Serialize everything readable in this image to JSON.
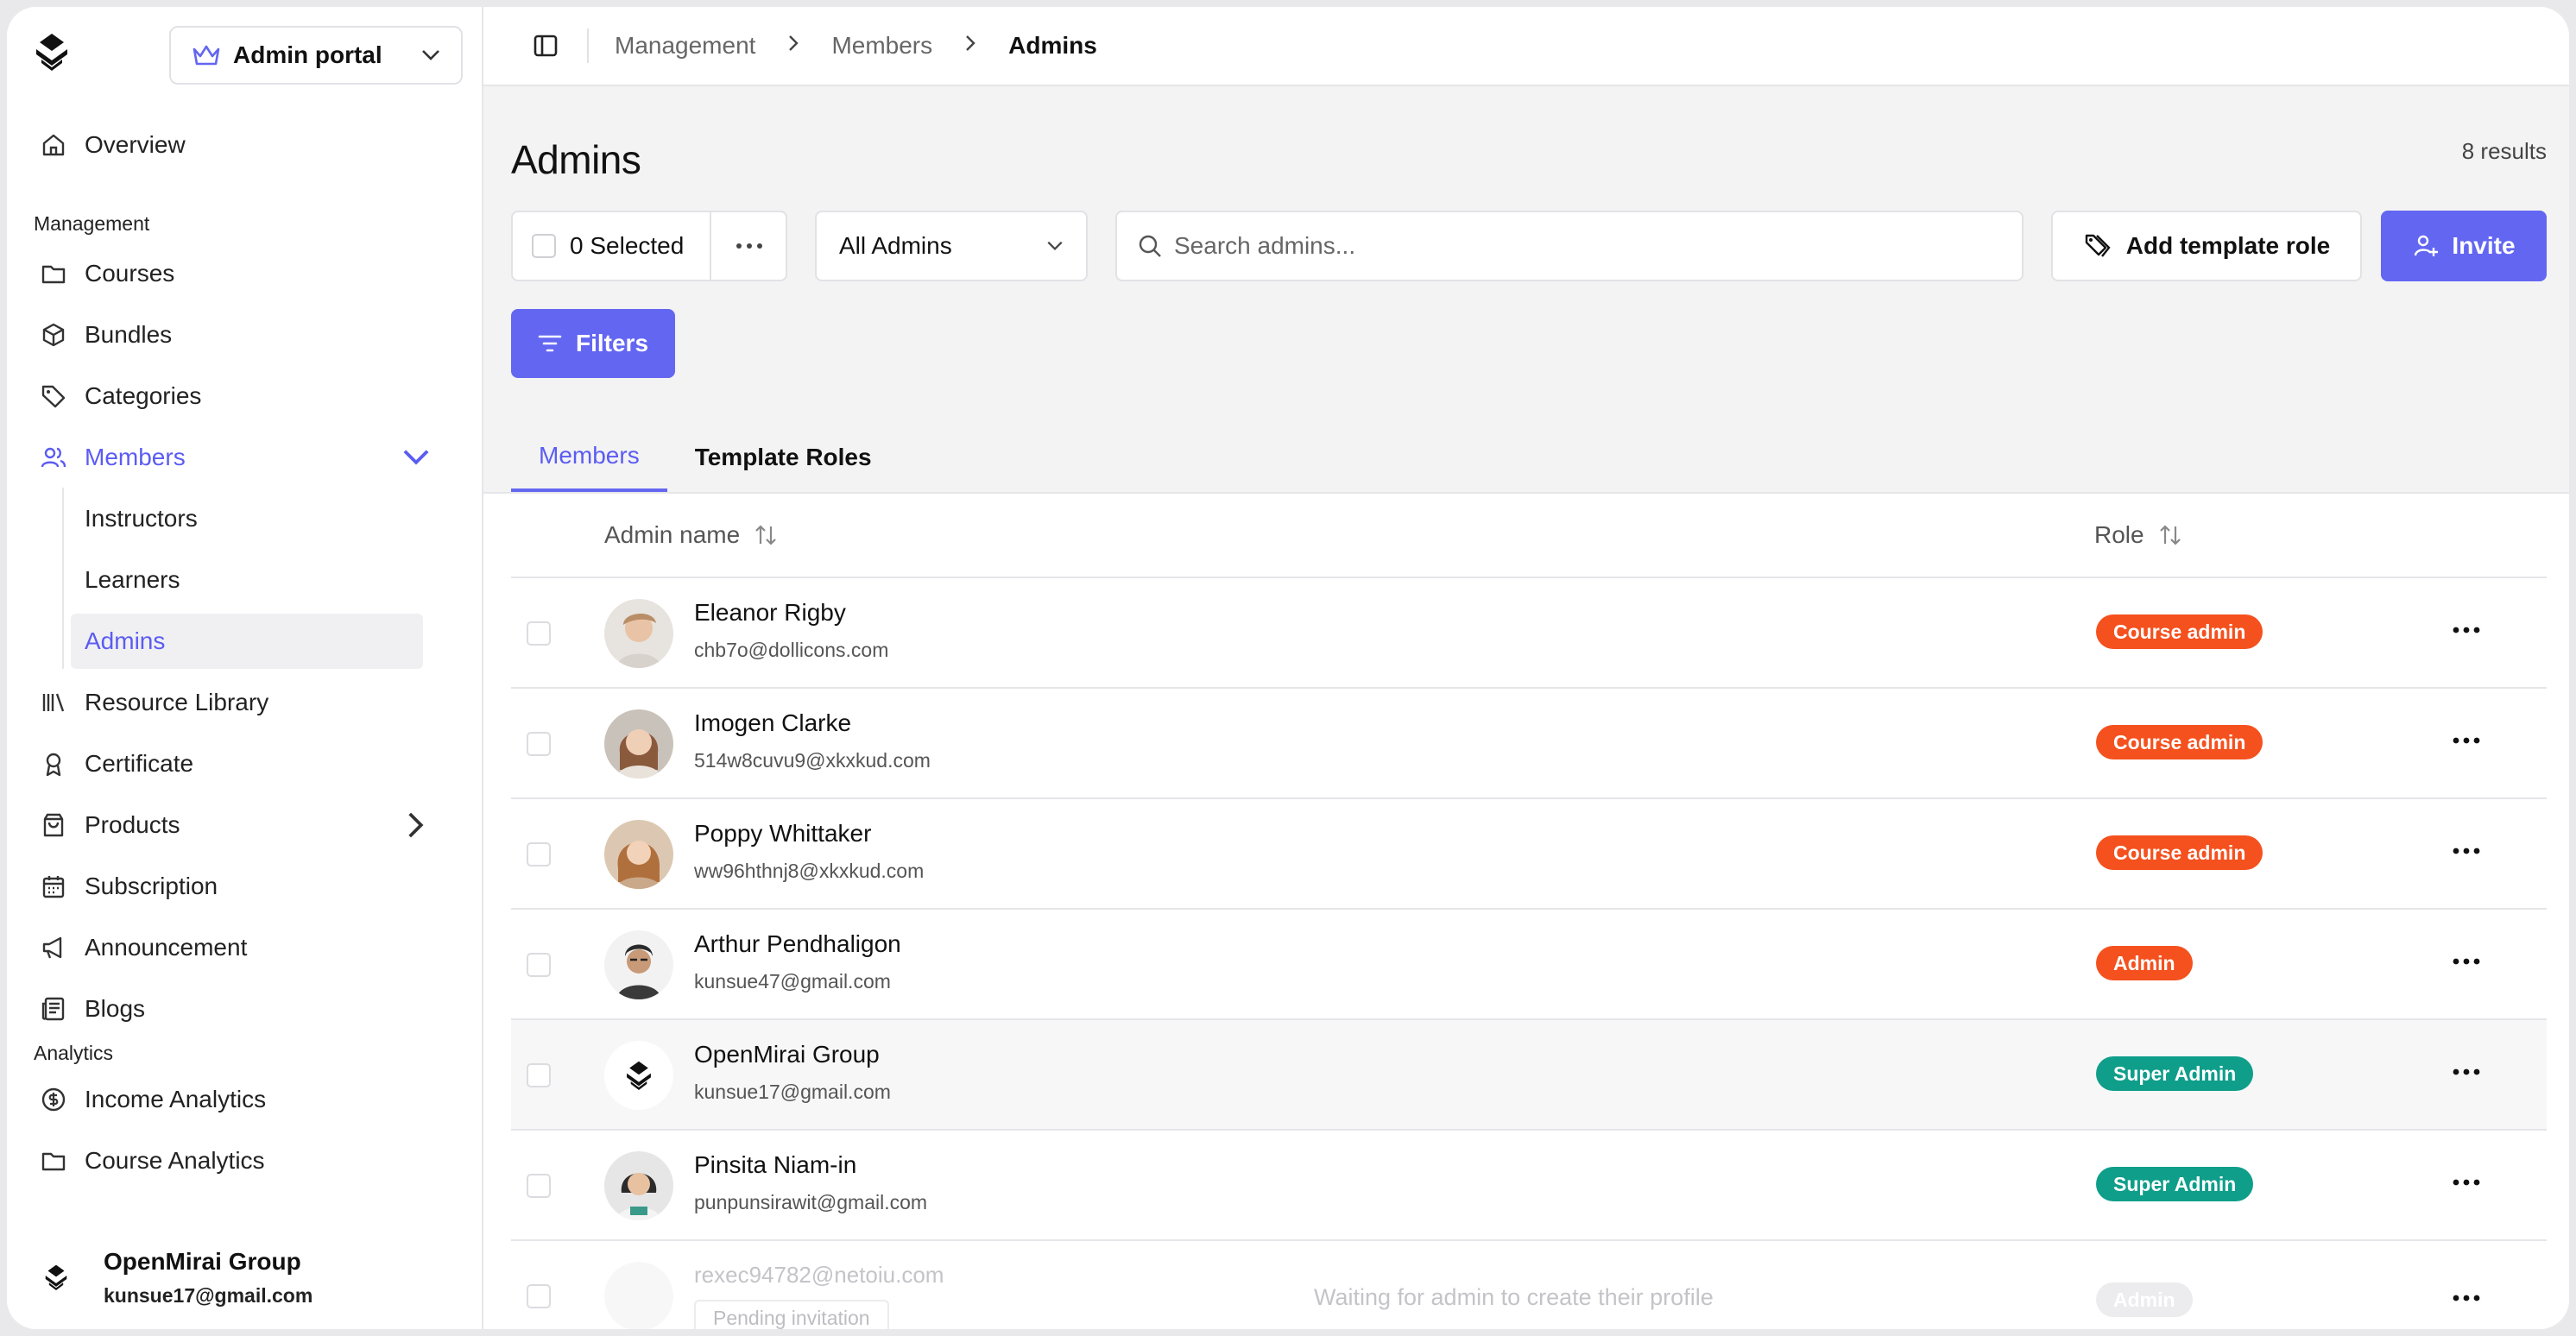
{
  "sidebar": {
    "portal_label": "Admin portal",
    "overview": "Overview",
    "section_management": "Management",
    "courses": "Courses",
    "bundles": "Bundles",
    "categories": "Categories",
    "members": "Members",
    "instructors": "Instructors",
    "learners": "Learners",
    "admins": "Admins",
    "resource_library": "Resource Library",
    "certificate": "Certificate",
    "products": "Products",
    "subscription": "Subscription",
    "announcement": "Announcement",
    "blogs": "Blogs",
    "section_analytics": "Analytics",
    "income_analytics": "Income Analytics",
    "course_analytics": "Course Analytics",
    "user": {
      "name": "OpenMirai Group",
      "email": "kunsue17@gmail.com"
    }
  },
  "breadcrumb": {
    "b1": "Management",
    "b2": "Members",
    "b3": "Admins"
  },
  "page": {
    "title": "Admins",
    "results": "8 results",
    "selected": "0 Selected",
    "filter_value": "All Admins",
    "search_placeholder": "Search admins...",
    "add_template_role": "Add template role",
    "invite": "Invite",
    "filters": "Filters"
  },
  "tabs": {
    "members": "Members",
    "template_roles": "Template Roles"
  },
  "table": {
    "col_name": "Admin name",
    "col_role": "Role",
    "rows": [
      {
        "name": "Eleanor Rigby",
        "email": "chb7o@dollicons.com",
        "role": "Course admin"
      },
      {
        "name": "Imogen Clarke",
        "email": "514w8cuvu9@xkxkud.com",
        "role": "Course admin"
      },
      {
        "name": "Poppy Whittaker",
        "email": "ww96hthnj8@xkxkud.com",
        "role": "Course admin"
      },
      {
        "name": "Arthur Pendhaligon",
        "email": "kunsue47@gmail.com",
        "role": "Admin"
      },
      {
        "name": "OpenMirai Group",
        "email": "kunsue17@gmail.com",
        "role": "Super Admin"
      },
      {
        "name": "Pinsita Niam-in",
        "email": "punpunsirawit@gmail.com",
        "role": "Super Admin"
      }
    ],
    "pending": {
      "email": "rexec94782@netoiu.com",
      "status": "Pending invitation",
      "note": "Waiting for admin to create their profile",
      "role": "Admin"
    }
  },
  "colors": {
    "accent": "#6366f1",
    "orange": "#f4511e",
    "teal": "#0f9e8a"
  }
}
